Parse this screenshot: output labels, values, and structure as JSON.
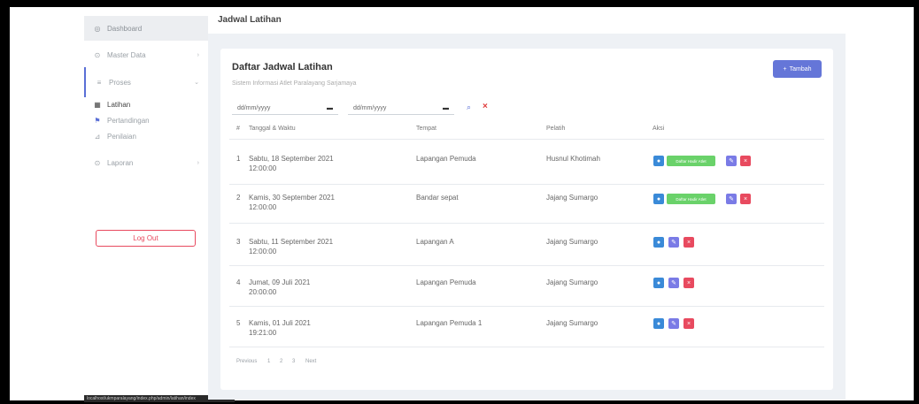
{
  "sidebar": {
    "items": [
      {
        "label": "Dashboard",
        "icon": "gauge-icon"
      },
      {
        "label": "Master Data",
        "icon": "database-icon"
      },
      {
        "label": "Proses",
        "icon": "list-icon"
      },
      {
        "label": "Latihan",
        "icon": "calendar-icon"
      },
      {
        "label": "Pertandingan",
        "icon": "trophy-icon"
      },
      {
        "label": "Penilaian",
        "icon": "chart-icon"
      },
      {
        "label": "Laporan",
        "icon": "file-icon"
      }
    ],
    "logout_label": "Log Out"
  },
  "page_title": "Jadwal Latihan",
  "card": {
    "title": "Daftar Jadwal Latihan",
    "subtitle": "Sistem Informasi Atlet Paralayang Sarjamaya",
    "add_label": "Tambah"
  },
  "filters": {
    "start_placeholder": "dd/mm/yyyy",
    "end_placeholder": "dd/mm/yyyy"
  },
  "table": {
    "headers": [
      "#",
      "Tanggal & Waktu",
      "Tempat",
      "Pelatih",
      "Aksi"
    ],
    "rows": [
      {
        "no": "1",
        "date": "Sabtu, 18 September 2021",
        "time": "12:00:00",
        "place": "Lapangan Pemuda",
        "coach": "Husnul Khotimah",
        "extra": "Daftar Hadir Atlet"
      },
      {
        "no": "2",
        "date": "Kamis, 30 September 2021",
        "time": "12:00:00",
        "place": "Bandar sepat",
        "coach": "Jajang Sumargo",
        "extra": "Daftar Hadir Atlet"
      },
      {
        "no": "3",
        "date": "Sabtu, 11 September 2021",
        "time": "12:00:00",
        "place": "Lapangan A",
        "coach": "Jajang Sumargo",
        "extra": ""
      },
      {
        "no": "4",
        "date": "Jumat, 09 Juli 2021",
        "time": "20:00:00",
        "place": "Lapangan Pemuda",
        "coach": "Jajang Sumargo",
        "extra": ""
      },
      {
        "no": "5",
        "date": "Kamis, 01 Juli 2021",
        "time": "19:21:00",
        "place": "Lapangan Pemuda 1",
        "coach": "Jajang Sumargo",
        "extra": ""
      }
    ]
  },
  "pagination": {
    "prev": "Previous",
    "pages": [
      "1",
      "2",
      "3"
    ],
    "next": "Next"
  },
  "status_url": "localhost/ukmparalayang/index.php/admin/latihan/index",
  "colors": {
    "accent": "#6576d8",
    "danger": "#e84a5f",
    "info": "#3a8ad8",
    "success": "#6ad26a",
    "edit": "#7a7be6"
  }
}
